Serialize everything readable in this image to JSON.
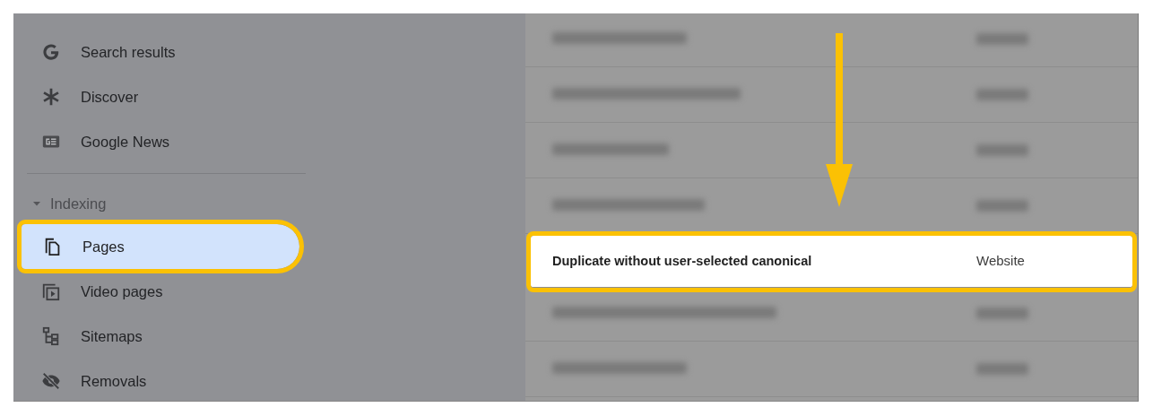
{
  "sidebar": {
    "items": [
      {
        "label": "Search results",
        "selected": false,
        "highlighted": false
      },
      {
        "label": "Discover",
        "selected": false,
        "highlighted": false
      },
      {
        "label": "Google News",
        "selected": false,
        "highlighted": false
      }
    ],
    "section": {
      "label": "Indexing",
      "expanded": true,
      "children": [
        {
          "label": "Pages",
          "selected": true,
          "highlighted": true
        },
        {
          "label": "Video pages",
          "selected": false,
          "highlighted": false
        },
        {
          "label": "Sitemaps",
          "selected": false,
          "highlighted": false
        },
        {
          "label": "Removals",
          "selected": false,
          "highlighted": false
        }
      ]
    }
  },
  "table": {
    "rows": [
      {
        "kind": "blurred"
      },
      {
        "kind": "blurred"
      },
      {
        "kind": "blurred"
      },
      {
        "kind": "blurred"
      },
      {
        "kind": "shown",
        "reason": "Duplicate without user-selected canonical",
        "source": "Website",
        "highlighted": true
      },
      {
        "kind": "blurred"
      },
      {
        "kind": "blurred"
      }
    ]
  },
  "annotation": {
    "kind": "arrow"
  }
}
